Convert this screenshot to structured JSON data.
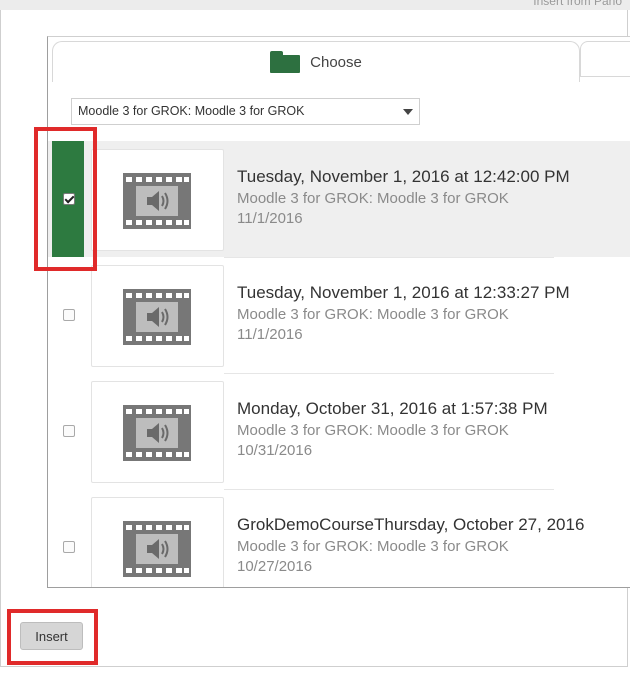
{
  "window": {
    "title": "Insert from Pano"
  },
  "tabs": {
    "choose_label": "Choose",
    "choose_icon": "folder-icon",
    "accent_color": "#2d7a40"
  },
  "course_select": {
    "value": "Moodle 3 for GROK: Moodle 3 for GROK"
  },
  "media": [
    {
      "title": "Tuesday, November 1, 2016 at 12:42:00 PM",
      "course": "Moodle 3 for GROK: Moodle 3 for GROK",
      "date": "11/1/2016",
      "selected": true,
      "icon": "video-audio-icon"
    },
    {
      "title": "Tuesday, November 1, 2016 at 12:33:27 PM",
      "course": "Moodle 3 for GROK: Moodle 3 for GROK",
      "date": "11/1/2016",
      "selected": false,
      "icon": "video-audio-icon"
    },
    {
      "title": "Monday, October 31, 2016 at 1:57:38 PM",
      "course": "Moodle 3 for GROK: Moodle 3 for GROK",
      "date": "10/31/2016",
      "selected": false,
      "icon": "video-audio-icon"
    },
    {
      "title": "GrokDemoCourseThursday, October 27, 2016",
      "course": "Moodle 3 for GROK: Moodle 3 for GROK",
      "date": "10/27/2016",
      "selected": false,
      "icon": "video-audio-icon"
    }
  ],
  "actions": {
    "insert_label": "Insert"
  }
}
